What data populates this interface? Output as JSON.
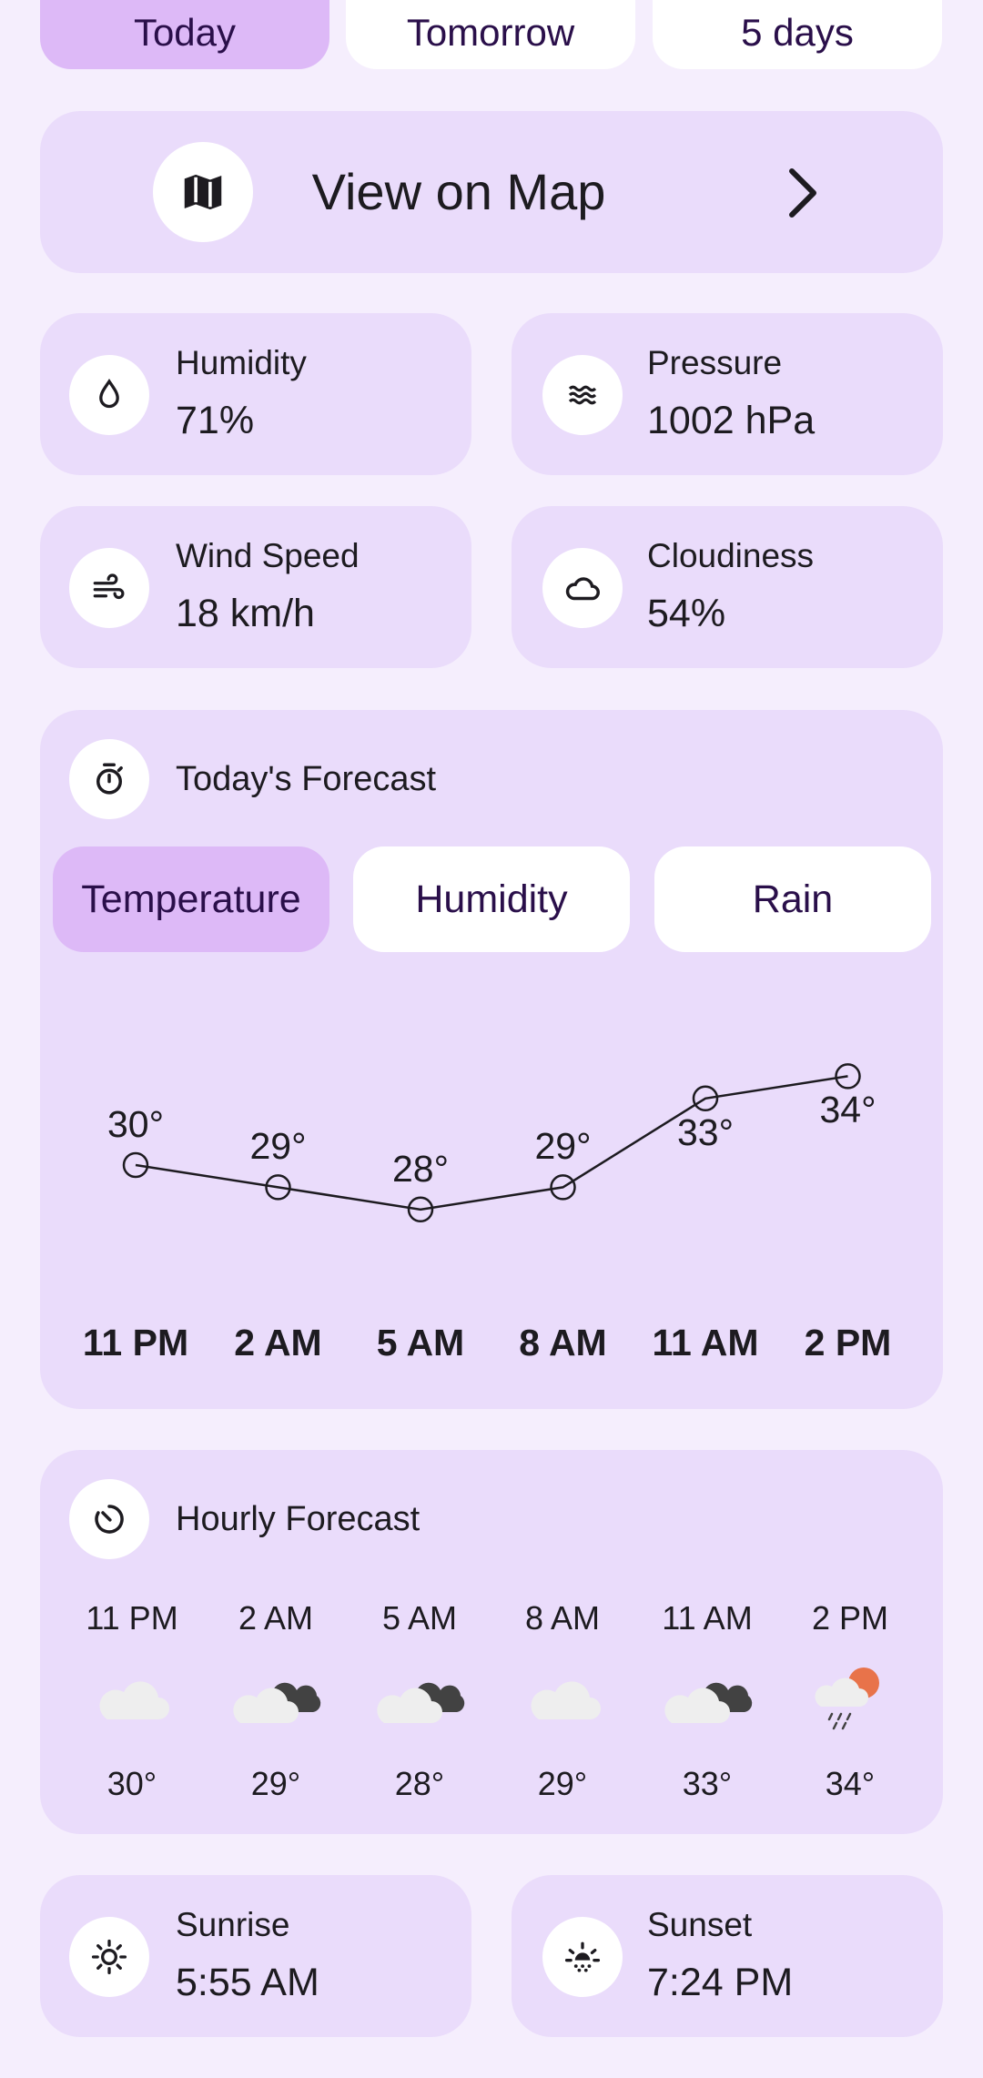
{
  "day_tabs": [
    {
      "label": "Today",
      "selected": true
    },
    {
      "label": "Tomorrow",
      "selected": false
    },
    {
      "label": "5 days",
      "selected": false
    }
  ],
  "map_card": {
    "label": "View on Map",
    "icon": "map-icon",
    "chevron": "chevron-right-icon"
  },
  "stats": {
    "humidity": {
      "label": "Humidity",
      "value": "71%",
      "icon": "water-drop-icon"
    },
    "pressure": {
      "label": "Pressure",
      "value": "1002 hPa",
      "icon": "waves-icon"
    },
    "wind": {
      "label": "Wind Speed",
      "value": "18 km/h",
      "icon": "wind-icon"
    },
    "cloudiness": {
      "label": "Cloudiness",
      "value": "54%",
      "icon": "cloud-icon"
    }
  },
  "todays_forecast": {
    "title": "Today's Forecast",
    "icon": "timer-icon",
    "tabs": [
      {
        "label": "Temperature",
        "selected": true
      },
      {
        "label": "Humidity",
        "selected": false
      },
      {
        "label": "Rain",
        "selected": false
      }
    ]
  },
  "chart_data": {
    "type": "line",
    "categories": [
      "11 PM",
      "2 AM",
      "5 AM",
      "8 AM",
      "11 AM",
      "2 PM"
    ],
    "values": [
      30,
      29,
      28,
      29,
      33,
      34
    ],
    "value_labels": [
      "30°",
      "29°",
      "28°",
      "29°",
      "33°",
      "34°"
    ],
    "title": "",
    "xlabel": "",
    "ylabel": "",
    "grid": false
  },
  "hourly_forecast": {
    "title": "Hourly Forecast",
    "icon": "clock-icon",
    "items": [
      {
        "time": "11 PM",
        "temp": "30°",
        "icon": "cloud-icon"
      },
      {
        "time": "2 AM",
        "temp": "29°",
        "icon": "cloud-dark-icon"
      },
      {
        "time": "5 AM",
        "temp": "28°",
        "icon": "cloud-dark-icon"
      },
      {
        "time": "8 AM",
        "temp": "29°",
        "icon": "cloud-icon"
      },
      {
        "time": "11 AM",
        "temp": "33°",
        "icon": "cloud-dark-icon"
      },
      {
        "time": "2 PM",
        "temp": "34°",
        "icon": "rain-sun-icon"
      }
    ]
  },
  "sun": {
    "sunrise": {
      "label": "Sunrise",
      "value": "5:55 AM",
      "icon": "sun-icon"
    },
    "sunset": {
      "label": "Sunset",
      "value": "7:24 PM",
      "icon": "sunset-icon"
    }
  },
  "colors": {
    "background": "#f5eefd",
    "card": "#eadcfb",
    "selected": "#ddb9f7",
    "sun_orange": "#e8734a",
    "cloud_light": "#eeeeee",
    "cloud_dark": "#424242"
  }
}
